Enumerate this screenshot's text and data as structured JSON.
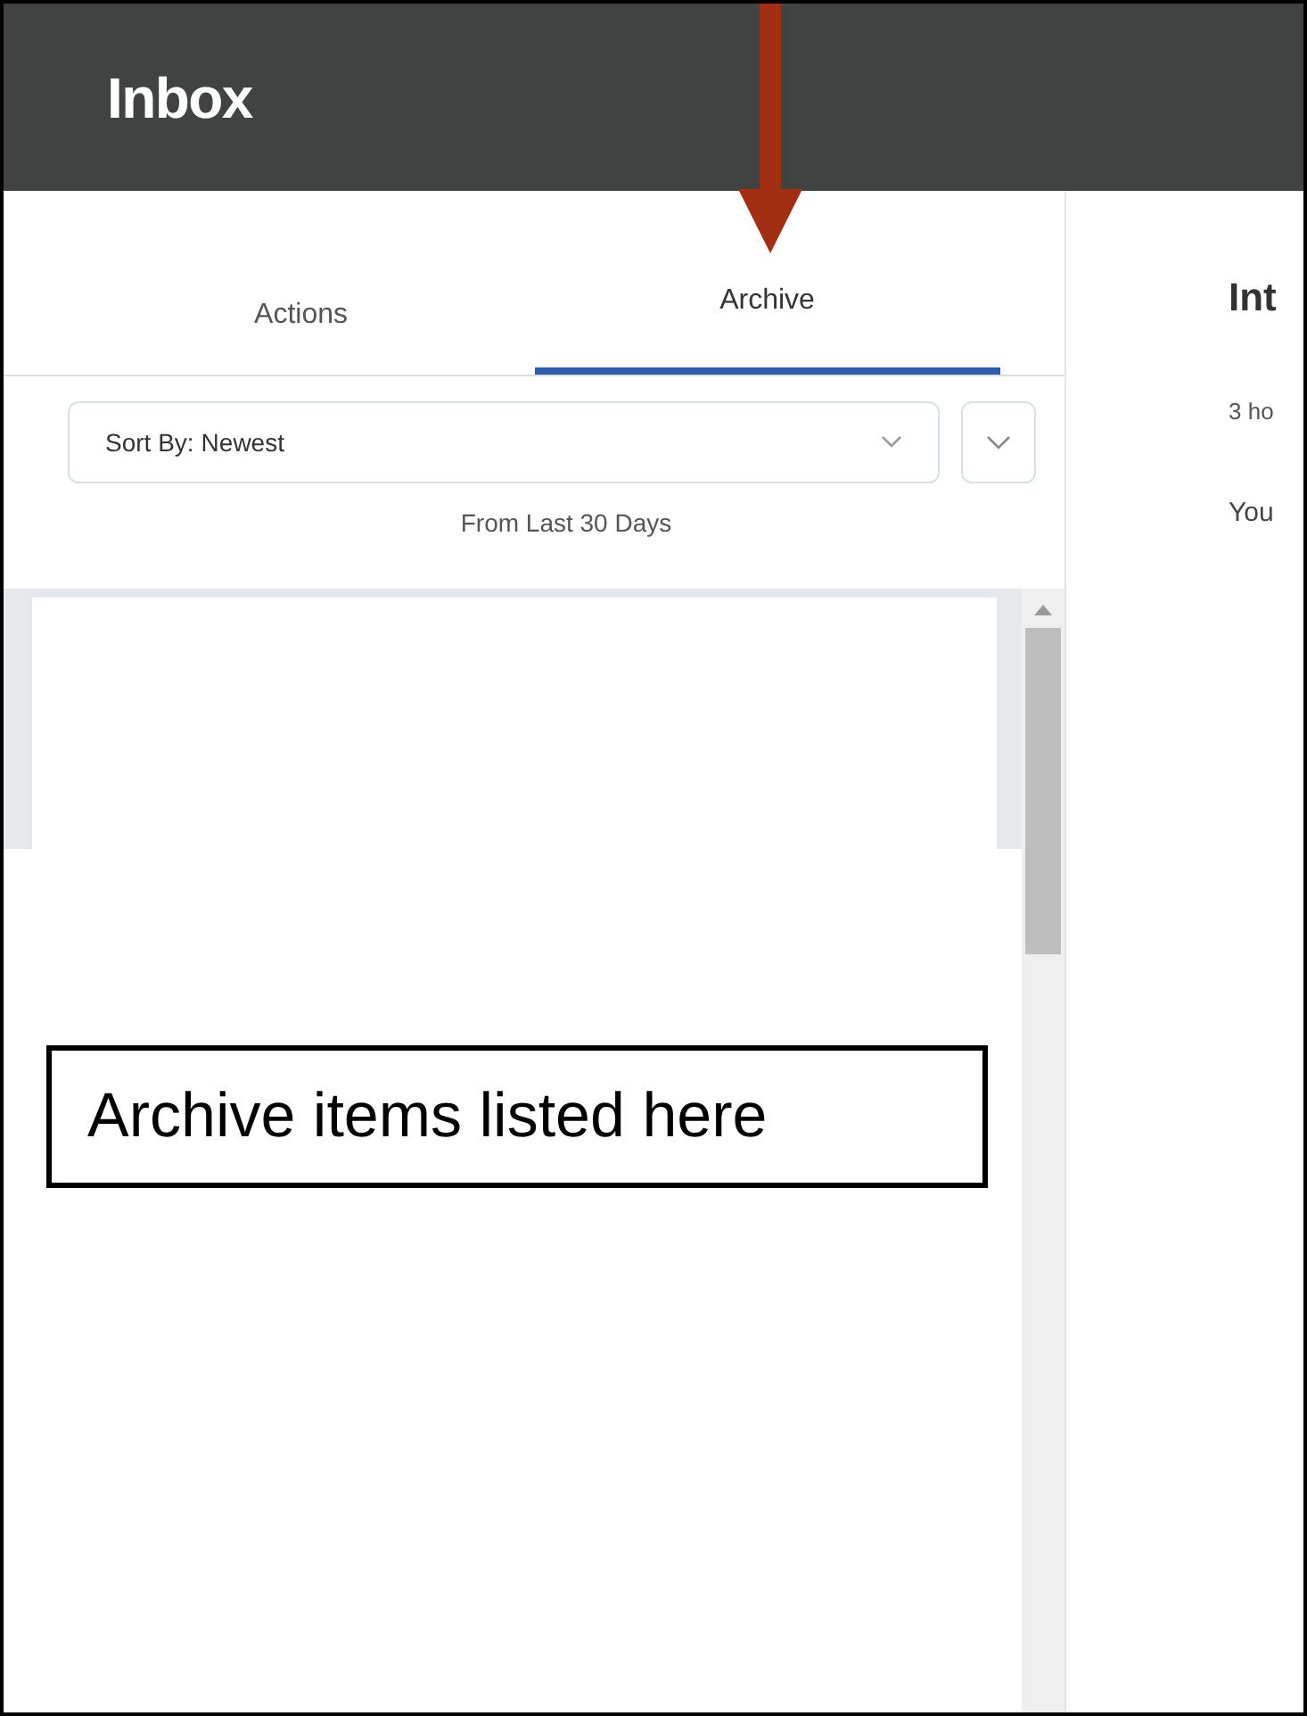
{
  "header": {
    "title": "Inbox"
  },
  "tabs": [
    {
      "label": "Actions",
      "selected": false
    },
    {
      "label": "Archive",
      "selected": true
    }
  ],
  "sort": {
    "label": "Sort By:",
    "value": "Newest"
  },
  "filter_note": "From Last 30 Days",
  "detail": {
    "title": "Int",
    "time": "3 ho",
    "body": "You"
  },
  "annotation": {
    "callout": "Archive items listed here"
  }
}
